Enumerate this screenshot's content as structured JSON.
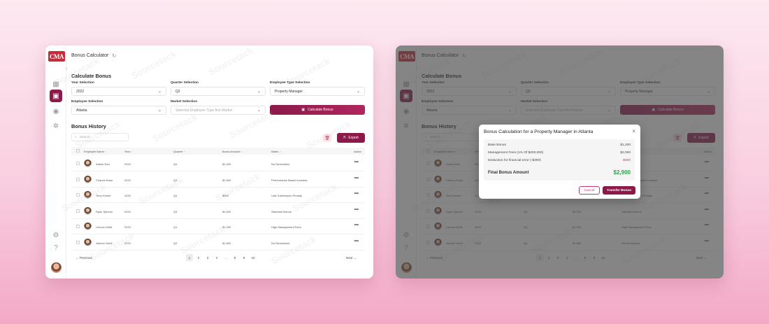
{
  "app": {
    "logo": "CMA",
    "title": "Bonus Calculator",
    "section_calculate": "Calculate Bonus",
    "section_history": "Bonus History",
    "watermark": "Sourcetack"
  },
  "form": {
    "year_label": "Year Selection",
    "year_value": "2022",
    "quarter_label": "Quarter Selection",
    "quarter_value": "Q2",
    "type_label": "Employee Type Selection",
    "type_value": "Property Manager",
    "employee_label": "Employee Selection",
    "employee_value": "Atlanta",
    "market_label": "Market Selection",
    "market_placeholder": "Selected Employee Type first Market",
    "calc_button": "Calculate Bonus"
  },
  "toolbar": {
    "search_placeholder": "Search",
    "export_label": "Export"
  },
  "table": {
    "headers": [
      "Employee Name",
      "Year",
      "Quarter",
      "Bonus Amount",
      "Notes",
      "Action"
    ],
    "rows": [
      {
        "name": "Adrian Deo",
        "year": "2023",
        "quarter": "Q4",
        "amount": "$1,200",
        "notes": "No Deductions"
      },
      {
        "name": "Chance Botor",
        "year": "2023",
        "quarter": "Q3",
        "amount": "$1,500",
        "notes": "Performance Based increase"
      },
      {
        "name": "Terry Kenter",
        "year": "2023",
        "quarter": "Q4",
        "amount": "$500",
        "notes": "Late Submission Penalty"
      },
      {
        "name": "Ryan Spinron",
        "year": "2023",
        "quarter": "Q3",
        "amount": "$1,000",
        "notes": "Standard Bonus"
      },
      {
        "name": "Lincoln Geidt",
        "year": "2023",
        "quarter": "Q1",
        "amount": "$1,200",
        "notes": "High Management Fees"
      },
      {
        "name": "Jaxdon Geidt",
        "year": "2023",
        "quarter": "Q2",
        "amount": "$1,500",
        "notes": "No Deductions"
      }
    ]
  },
  "pagination": {
    "prev": "Previous",
    "next": "Next",
    "pages": [
      "1",
      "2",
      "3",
      "4",
      "...",
      "8",
      "9",
      "10"
    ],
    "current": "1"
  },
  "modal": {
    "title": "Bonus Calculation for a Property Manager in Atlanta",
    "base_label": "Base Bonus",
    "base_value": "$1,200",
    "fees_label": "Management Fees (1% Of $200,000)",
    "fees_value": "$2,000",
    "deduction_label": "Deduction for financial error (-$300)",
    "deduction_value": "-$300",
    "final_label": "Final Bonus Amount",
    "final_value": "$2,900",
    "cancel": "Cancel",
    "transfer": "Transfer Bonus"
  },
  "colors": {
    "primary": "#8b1a4a",
    "negative": "#d23c45",
    "positive": "#2ba24c"
  }
}
